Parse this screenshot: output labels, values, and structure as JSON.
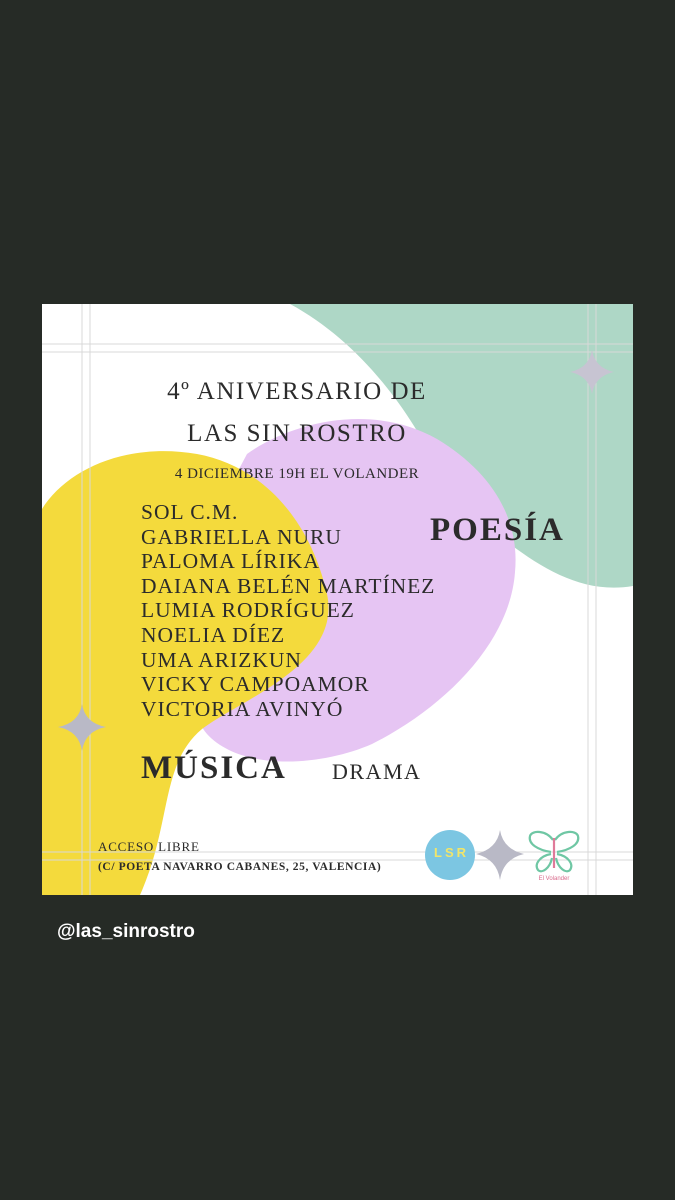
{
  "colors": {
    "story_background": "#262b26",
    "poster_background": "#ffffff",
    "blob_green": "#aed7c6",
    "blob_purple": "#e6c5f3",
    "blob_yellow": "#f4da3c",
    "sparkle_gray": "#b9b9c6",
    "text": "#2b2b2b"
  },
  "poster": {
    "title_line_1": "4º ANIVERSARIO DE",
    "title_line_2": "LAS SIN ROSTRO",
    "subtitle": "4 DICIEMBRE 19H EL VOLANDER",
    "lineup": [
      "SOL C.M.",
      "GABRIELLA NURU",
      "PALOMA LÍRIKA",
      "DAIANA BELÉN MARTÍNEZ",
      "LUMIA RODRÍGUEZ",
      "NOELIA DÍEZ",
      "UMA ARIZKUN",
      "VICKY CAMPOAMOR",
      "VICTORIA AVINYÓ"
    ],
    "category_poesia": "POESÍA",
    "category_musica": "MÚSICA",
    "category_drama": "DRAMA",
    "access": "ACCESO LIBRE",
    "address": "(C/ POETA NAVARRO CABANES, 25, VALENCIA)",
    "logo_lsr_text": "LSR",
    "logo_volander_caption": "El Volander"
  },
  "story": {
    "mention": "@las_sinrostro"
  }
}
